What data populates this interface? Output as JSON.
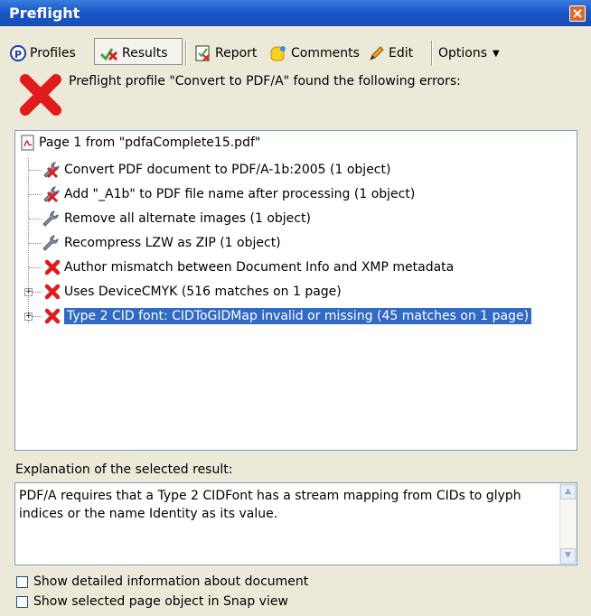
{
  "window": {
    "title": "Preflight"
  },
  "toolbar": {
    "profiles": "Profiles",
    "results": "Results",
    "report": "Report",
    "comments": "Comments",
    "edit": "Edit",
    "options": "Options"
  },
  "summary": {
    "text": "Preflight profile \"Convert to PDF/A\" found the following errors:"
  },
  "tree": {
    "root": "Page 1 from \"pdfaComplete15.pdf\"",
    "items": [
      {
        "label": "Convert PDF document to PDF/A-1b:2005 (1 object)",
        "icon": "fix-error-icon"
      },
      {
        "label": "Add \"_A1b\" to PDF file name after processing (1 object)",
        "icon": "fix-error-icon"
      },
      {
        "label": "Remove all alternate images (1 object)",
        "icon": "wrench-icon"
      },
      {
        "label": "Recompress LZW as ZIP  (1 object)",
        "icon": "wrench-icon"
      },
      {
        "label": "Author mismatch between Document Info and XMP metadata",
        "icon": "error-icon"
      },
      {
        "label": "Uses DeviceCMYK (516 matches on 1 page)",
        "icon": "error-icon"
      },
      {
        "label": "Type 2 CID font: CIDToGIDMap invalid or missing (45 matches on 1 page)",
        "icon": "error-icon"
      }
    ]
  },
  "explanation": {
    "label": "Explanation of the selected result:",
    "text": "PDF/A requires that a Type 2 CIDFont has a stream mapping from CIDs to glyph indices or the name Identity as its value."
  },
  "options": {
    "detailed_info": "Show detailed information about document",
    "snap_view": "Show selected page object in Snap view"
  },
  "colors": {
    "titlebar": "#1a57c7",
    "selection": "#316ac5",
    "error_red": "#e01b1b"
  }
}
